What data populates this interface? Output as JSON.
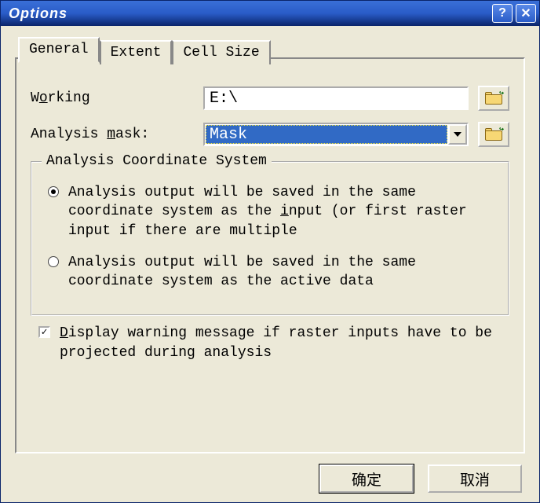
{
  "window": {
    "title": "Options"
  },
  "tabs": {
    "general": "General",
    "extent": "Extent",
    "cellsize": "Cell Size"
  },
  "general": {
    "working_pre": "W",
    "working_u": "o",
    "working_post": "rking",
    "working_value": "E:\\",
    "mask_pre": "Analysis ",
    "mask_u": "m",
    "mask_post": "ask:",
    "mask_value": "Mask",
    "group_title": "Analysis Coordinate System",
    "radio1_pre": "Analysis output will be saved in the same coordinate system as the ",
    "radio1_u": "i",
    "radio1_mid": "nput (or first raster input if there are multiple",
    "radio2": "Analysis output will be saved in the same coordinate system as the active data",
    "check_u": "D",
    "check_post": "isplay warning message if raster inputs have to be projected during analysis"
  },
  "buttons": {
    "ok": "确定",
    "cancel": "取消"
  }
}
